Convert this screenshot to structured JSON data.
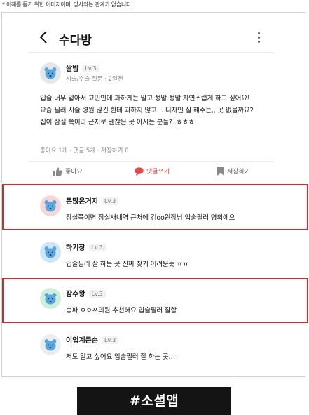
{
  "disclaimer": "* 이해를 돕기 위한 이미지이며, 당사와는 관계가 없습니다.",
  "header": {
    "title": "수다방"
  },
  "post": {
    "author": "쌀밥",
    "level": "Lv.3",
    "meta": "시술/수술 질문 · 2일전",
    "body_lines": [
      "입술 너무 얇아서 고민인데 과하게는 말고 정말 정말 자연스럽게 하고 싶어요!",
      "요즘 필러 시술 병원 많긴 한데 과하지 않고… 디자인 잘 해주는,, 곳 없을까요?",
      "집이 잠실 쪽이라 근처로 괜찮은 곳 아시는 분들?..ㅎㅎㅎ"
    ],
    "stats": "좋아요 1개 · 댓글 5개 · 저장하기 0"
  },
  "actions": {
    "like": "좋아요",
    "comment": "댓글쓰기",
    "save": "저장하기"
  },
  "comments": [
    {
      "name": "돈많은거지",
      "level": "Lv.3",
      "text": "잠실쪽이면 잠실새내역 근처에 김oo원장님 입술필러 명의에요",
      "avatar_color": "#f8d6d8",
      "highlighted": true
    },
    {
      "name": "하기장",
      "level": "Lv.3",
      "text": "입술필러 잘 하는 곳 진짜 찾기 어려운듯 ㅠㅠ",
      "avatar_color": "#cfe6f7",
      "highlighted": false
    },
    {
      "name": "잠수왕",
      "level": "Lv.3",
      "text": "송파 ㅇㅇㅆ의원 추천해요 입술필러 잘함",
      "avatar_color": "#cdeed8",
      "highlighted": true
    },
    {
      "name": "이업계큰손",
      "level": "Lv.3",
      "text": "저도 알고 싶어요 입술필러 잘 하는 곳…",
      "avatar_color": "#ededed",
      "highlighted": false
    }
  ],
  "hashtag": "#소셜앱",
  "colors": {
    "highlight": "#d7262d",
    "accent_red": "#e04a4a",
    "bear_blue": "#5aa7e0"
  }
}
